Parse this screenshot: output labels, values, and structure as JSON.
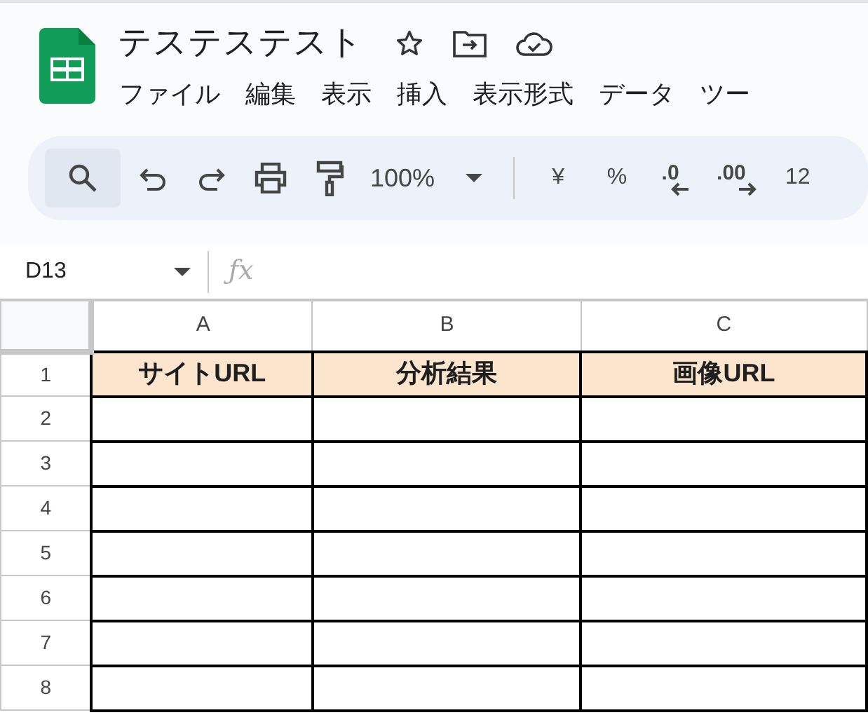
{
  "document": {
    "title": "テステステスト"
  },
  "menu": [
    "ファイル",
    "編集",
    "表示",
    "挿入",
    "表示形式",
    "データ",
    "ツー"
  ],
  "toolbar": [
    {
      "kind": "search",
      "selected": true
    },
    {
      "kind": "undo",
      "selected": false
    },
    {
      "kind": "redo",
      "selected": false
    },
    {
      "kind": "print",
      "selected": false
    },
    {
      "kind": "paint",
      "selected": false
    },
    {
      "kind": "zoom",
      "label": "100%",
      "selected": false
    },
    {
      "kind": "divider"
    },
    {
      "kind": "text",
      "label": "¥",
      "selected": false
    },
    {
      "kind": "text",
      "label": "%",
      "selected": false
    },
    {
      "kind": "decimal-less",
      "label": ".0",
      "selected": false
    },
    {
      "kind": "decimal-more",
      "label": ".00",
      "selected": false
    },
    {
      "kind": "text",
      "label": "12",
      "selected": false
    }
  ],
  "formula_bar": {
    "name_box": "D13",
    "function_label": "ƒx"
  },
  "sheet": {
    "columns": [
      "A",
      "B",
      "C"
    ],
    "rows": [
      {
        "number": "1",
        "cells": [
          "サイトURL",
          "分析結果",
          "画像URL"
        ]
      },
      {
        "number": "2"
      },
      {
        "number": "3"
      },
      {
        "number": "4"
      },
      {
        "number": "5"
      },
      {
        "number": "6"
      },
      {
        "number": "7"
      },
      {
        "number": "8"
      }
    ]
  }
}
